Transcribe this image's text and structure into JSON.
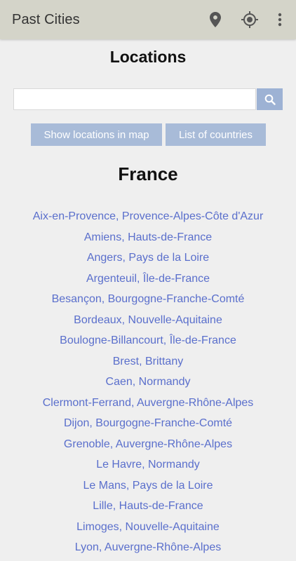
{
  "app_bar": {
    "title": "Past Cities",
    "icons": [
      "map-pin-icon",
      "locate-icon",
      "more-vert-icon"
    ]
  },
  "page": {
    "title": "Locations"
  },
  "search": {
    "value": "",
    "placeholder": ""
  },
  "buttons": {
    "show_map": "Show locations in map",
    "list_countries": "List of countries"
  },
  "country": {
    "name": "France",
    "locations": [
      "Aix-en-Provence, Provence-Alpes-Côte d'Azur",
      "Amiens, Hauts-de-France",
      "Angers, Pays de la Loire",
      "Argenteuil, Île-de-France",
      "Besançon, Bourgogne-Franche-Comté",
      "Bordeaux, Nouvelle-Aquitaine",
      "Boulogne-Billancourt, Île-de-France",
      "Brest, Brittany",
      "Caen, Normandy",
      "Clermont-Ferrand, Auvergne-Rhône-Alpes",
      "Dijon, Bourgogne-Franche-Comté",
      "Grenoble, Auvergne-Rhône-Alpes",
      "Le Havre, Normandy",
      "Le Mans, Pays de la Loire",
      "Lille, Hauts-de-France",
      "Limoges, Nouvelle-Aquitaine",
      "Lyon, Auvergne-Rhône-Alpes"
    ]
  },
  "colors": {
    "app_bar": "#d4d4c9",
    "background": "#efefef",
    "button": "#a8bbd8",
    "search_button": "#9db2d4",
    "link": "#5a6fcc"
  }
}
